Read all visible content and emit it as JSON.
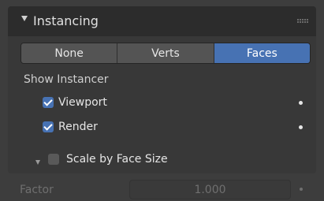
{
  "panel": {
    "title": "Instancing",
    "instancing_modes": [
      {
        "label": "None",
        "active": false
      },
      {
        "label": "Verts",
        "active": false
      },
      {
        "label": "Faces",
        "active": true
      }
    ],
    "show_instancer_label": "Show Instancer",
    "viewport": {
      "label": "Viewport",
      "checked": true
    },
    "render": {
      "label": "Render",
      "checked": true
    },
    "scale_by_face_size": {
      "label": "Scale by Face Size",
      "checked": false
    },
    "factor": {
      "label": "Factor",
      "value": "1.000"
    }
  },
  "colors": {
    "accent": "#4772b3",
    "panel_bg": "#383838",
    "header_bg": "#2c2c2c"
  },
  "icons": [
    "collapse-arrow-icon",
    "drag-grip-icon",
    "checkmark-icon",
    "keyframe-dot-icon"
  ]
}
